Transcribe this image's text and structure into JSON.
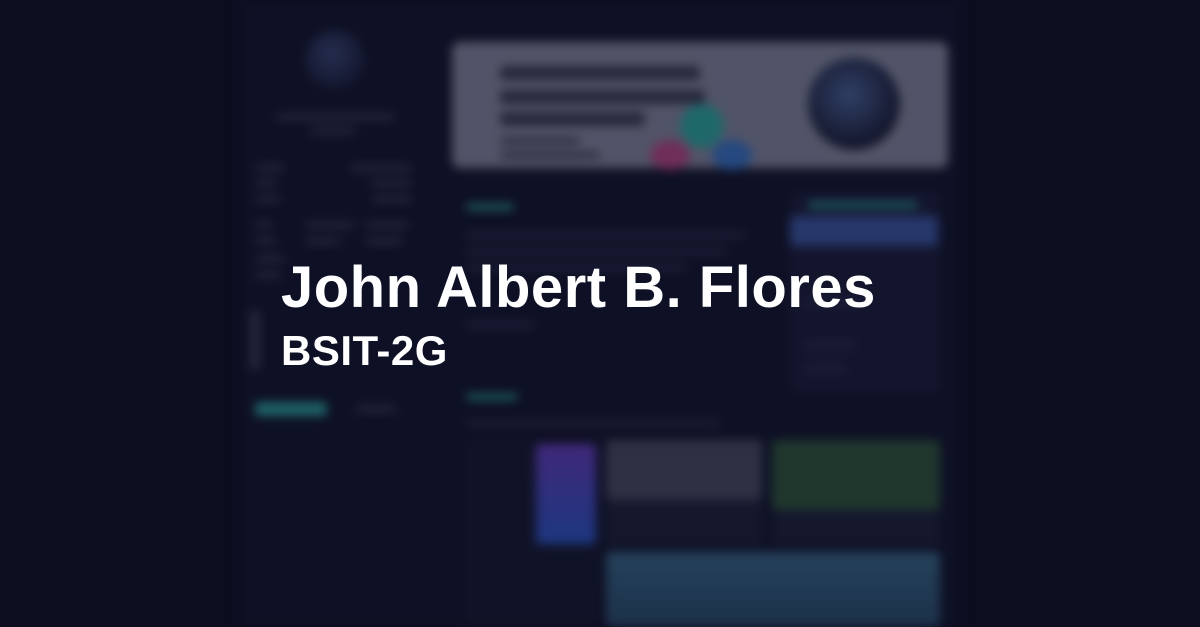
{
  "title": {
    "name": "John Albert B. Flores",
    "section": "BSIT-2G"
  },
  "colors": {
    "background": "#0c0d1f",
    "accent": "#2fa8a0",
    "text": "#ffffff"
  }
}
